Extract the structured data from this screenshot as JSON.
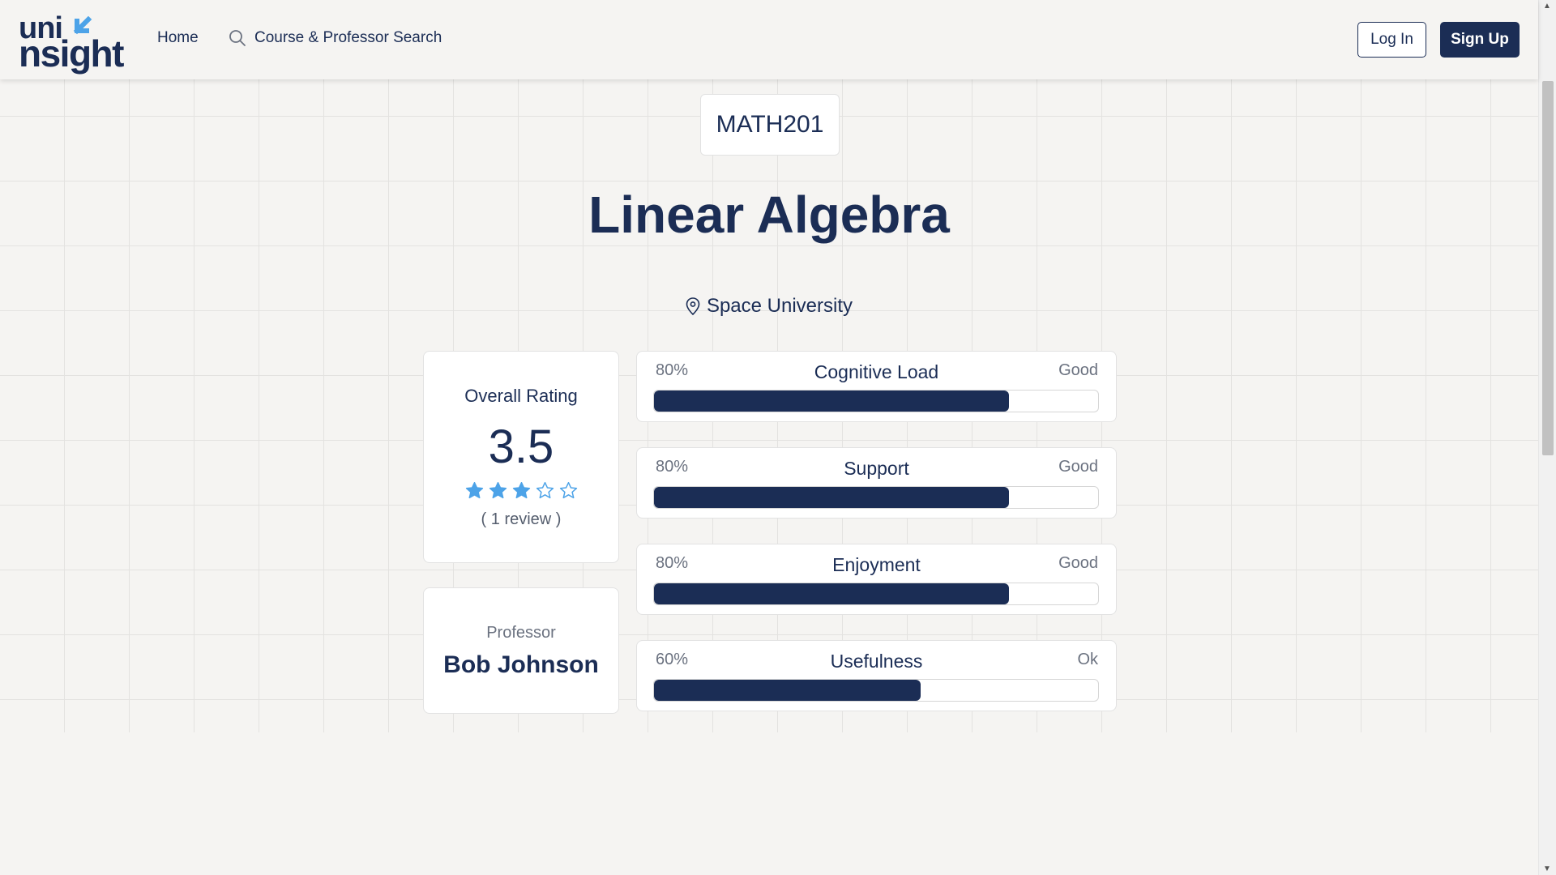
{
  "header": {
    "logo_top": "uni",
    "logo_bottom": "nsight",
    "nav_home": "Home",
    "nav_search": "Course & Professor Search",
    "login_label": "Log In",
    "signup_label": "Sign Up"
  },
  "course": {
    "code": "MATH201",
    "title": "Linear Algebra",
    "university": "Space University"
  },
  "rating": {
    "label": "Overall Rating",
    "score": "3.5",
    "stars_filled": 3,
    "stars_total": 5,
    "reviews": "( 1 review )"
  },
  "professor": {
    "label": "Professor",
    "name": "Bob Johnson"
  },
  "metrics": [
    {
      "name": "Cognitive Load",
      "percent_label": "80%",
      "verdict": "Good",
      "value": 0.8
    },
    {
      "name": "Support",
      "percent_label": "80%",
      "verdict": "Good",
      "value": 0.8
    },
    {
      "name": "Enjoyment",
      "percent_label": "80%",
      "verdict": "Good",
      "value": 0.8
    },
    {
      "name": "Usefulness",
      "percent_label": "60%",
      "verdict": "Ok",
      "value": 0.6
    }
  ],
  "colors": {
    "primary": "#1b2d55",
    "accent_star": "#4da3e8",
    "logo_arrow": "#4da3e8",
    "background": "#f5f4f2"
  },
  "icons": {
    "search": "search-icon",
    "location": "location-pin-icon",
    "star": "star-icon"
  }
}
